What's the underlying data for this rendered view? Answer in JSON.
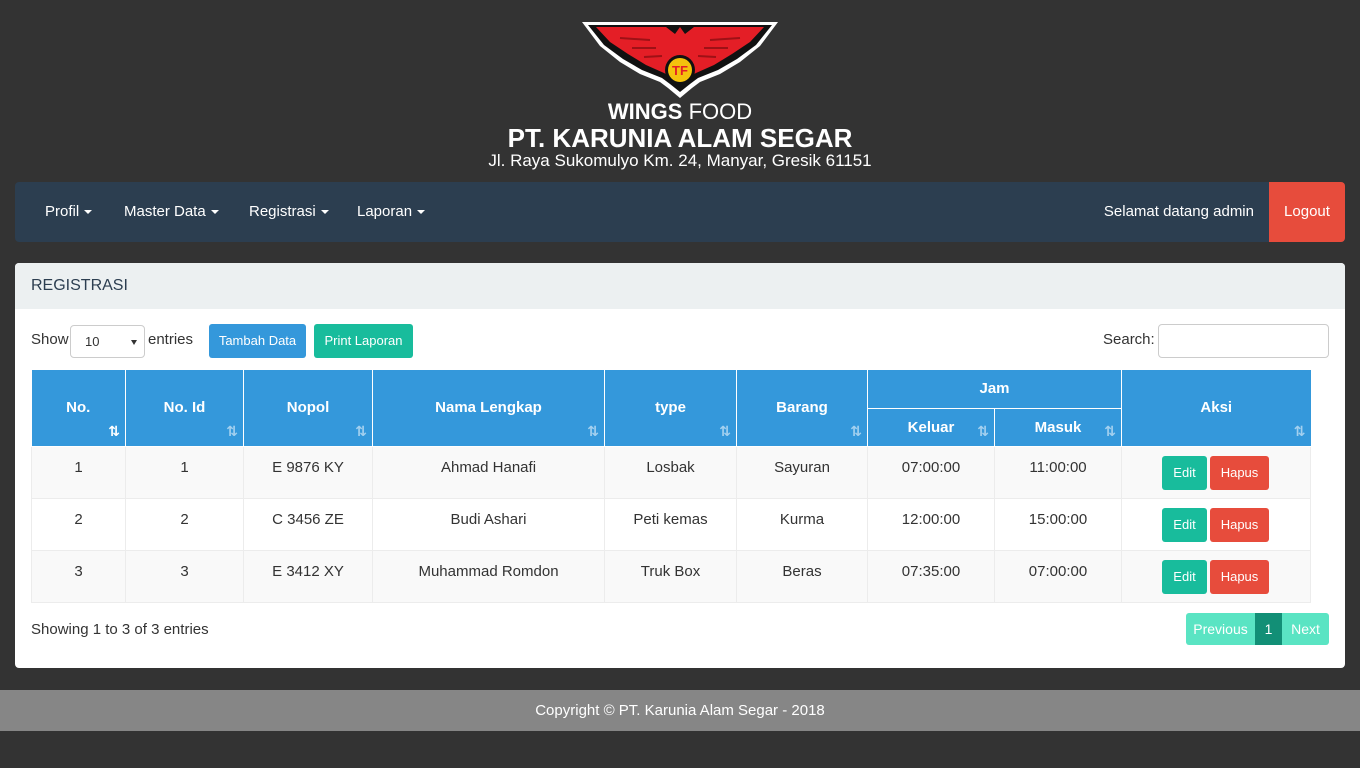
{
  "brand": {
    "wings_bold": "WINGS",
    "wings_light": "FOOD",
    "company": "PT. KARUNIA ALAM SEGAR",
    "address": "Jl. Raya Sukomulyo Km. 24, Manyar, Gresik 61151",
    "logo_icon": "wings-logo-icon"
  },
  "navbar": {
    "items": [
      {
        "label": "Profil"
      },
      {
        "label": "Master Data"
      },
      {
        "label": "Registrasi"
      },
      {
        "label": "Laporan"
      }
    ],
    "welcome": "Selamat datang admin",
    "logout": "Logout"
  },
  "panel": {
    "title": "REGISTRASI",
    "show_label": "Show",
    "entries_label": "entries",
    "page_length": "10",
    "add_button": "Tambah Data",
    "print_button": "Print Laporan",
    "search_label": "Search:",
    "search_value": ""
  },
  "table": {
    "headers": {
      "no": "No.",
      "no_id": "No. Id",
      "nopol": "Nopol",
      "nama": "Nama Lengkap",
      "type": "type",
      "barang": "Barang",
      "jam": "Jam",
      "keluar": "Keluar",
      "masuk": "Masuk",
      "aksi": "Aksi"
    },
    "rows": [
      {
        "no": "1",
        "no_id": "1",
        "nopol": "E 9876 KY",
        "nama": "Ahmad Hanafi",
        "type": "Losbak",
        "barang": "Sayuran",
        "keluar": "07:00:00",
        "masuk": "11:00:00",
        "edit": "Edit",
        "hapus": "Hapus"
      },
      {
        "no": "2",
        "no_id": "2",
        "nopol": "C 3456 ZE",
        "nama": "Budi Ashari",
        "type": "Peti kemas",
        "barang": "Kurma",
        "keluar": "12:00:00",
        "masuk": "15:00:00",
        "edit": "Edit",
        "hapus": "Hapus"
      },
      {
        "no": "3",
        "no_id": "3",
        "nopol": "E 3412 XY",
        "nama": "Muhammad Romdon",
        "type": "Truk Box",
        "barang": "Beras",
        "keluar": "07:35:00",
        "masuk": "07:00:00",
        "edit": "Edit",
        "hapus": "Hapus"
      }
    ],
    "info": "Showing 1 to 3 of 3 entries"
  },
  "pagination": {
    "previous": "Previous",
    "current": "1",
    "next": "Next"
  },
  "footer": {
    "copyright": "Copyright © PT. Karunia Alam Segar - 2018"
  },
  "colors": {
    "background": "#333333",
    "navbar": "#2c3e50",
    "primary": "#3498db",
    "success": "#18bc9c",
    "danger": "#e74c3c",
    "footer": "#868686"
  }
}
